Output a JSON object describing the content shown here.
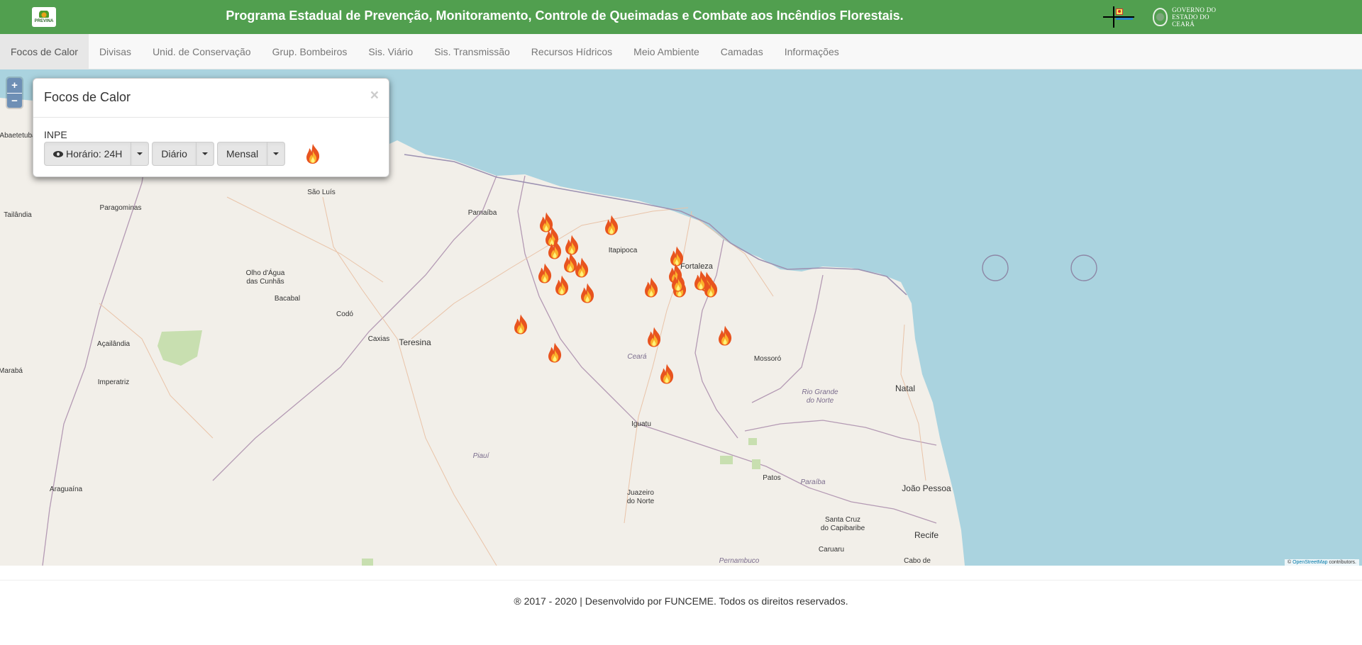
{
  "header": {
    "title": "Programa Estadual de Prevenção, Monitoramento, Controle de Queimadas e Combate aos Incêndios Florestais.",
    "logo_left_text": "PREVINA",
    "logo_right_line1": "GOVERNO DO",
    "logo_right_line2": "ESTADO DO CEARÁ"
  },
  "nav": {
    "items": [
      {
        "label": "Focos de Calor",
        "active": true
      },
      {
        "label": "Divisas"
      },
      {
        "label": "Unid. de Conservação"
      },
      {
        "label": "Grup. Bombeiros"
      },
      {
        "label": "Sis. Viário"
      },
      {
        "label": "Sis. Transmissão"
      },
      {
        "label": "Recursos Hídricos"
      },
      {
        "label": "Meio Ambiente"
      },
      {
        "label": "Camadas"
      },
      {
        "label": "Informações"
      }
    ]
  },
  "map": {
    "zoom_in": "+",
    "zoom_out": "−",
    "attribution_prefix": "©",
    "attribution_link": "OpenStreetMap",
    "attribution_suffix": "contributors.",
    "labels": [
      {
        "text": "Abaetetuba"
      },
      {
        "text": "São Luís"
      },
      {
        "text": "Tailândia"
      },
      {
        "text": "Paragominas"
      },
      {
        "text": "Parnaíba"
      },
      {
        "text": "Itapipoca"
      },
      {
        "text": "Fortaleza"
      },
      {
        "text": "Olho d'Água"
      },
      {
        "text": "das Cunhãs"
      },
      {
        "text": "Bacabal"
      },
      {
        "text": "Codó"
      },
      {
        "text": "Caxias"
      },
      {
        "text": "Teresina"
      },
      {
        "text": "Açailândia"
      },
      {
        "text": "Marabá"
      },
      {
        "text": "Imperatriz"
      },
      {
        "text": "Mossoró"
      },
      {
        "text": "Natal"
      },
      {
        "text": "Ceará"
      },
      {
        "text": "Rio Grande"
      },
      {
        "text": "do Norte"
      },
      {
        "text": "Iguatu"
      },
      {
        "text": "Piauí"
      },
      {
        "text": "Patos"
      },
      {
        "text": "Paraíba"
      },
      {
        "text": "João Pessoa"
      },
      {
        "text": "Araguaína"
      },
      {
        "text": "Juazeiro"
      },
      {
        "text": "do Norte"
      },
      {
        "text": "Santa Cruz"
      },
      {
        "text": "do Capibaribe"
      },
      {
        "text": "Caruaru"
      },
      {
        "text": "Recife"
      },
      {
        "text": "Pernambuco"
      },
      {
        "text": "Cabo de"
      }
    ],
    "fire_icon": "fire-icon"
  },
  "panel": {
    "title": "Focos de Calor",
    "close": "×",
    "source_label": "INPE",
    "btn_hour": "Horário: 24H",
    "btn_daily": "Diário",
    "btn_monthly": "Mensal"
  },
  "footer": {
    "text": "® 2017 - 2020 | Desenvolvido por FUNCEME. Todos os direitos reservados."
  }
}
